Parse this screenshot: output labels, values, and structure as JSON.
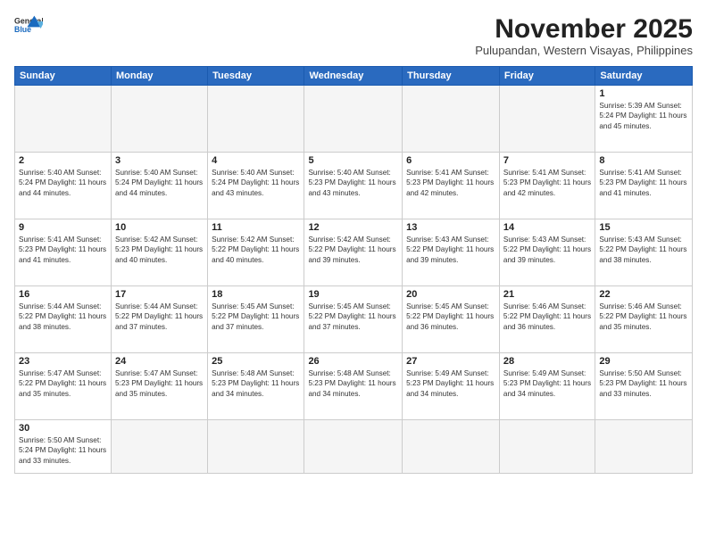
{
  "header": {
    "logo_line1": "General",
    "logo_line2": "Blue",
    "month_title": "November 2025",
    "location": "Pulupandan, Western Visayas, Philippines"
  },
  "days_of_week": [
    "Sunday",
    "Monday",
    "Tuesday",
    "Wednesday",
    "Thursday",
    "Friday",
    "Saturday"
  ],
  "weeks": [
    [
      {
        "day": "",
        "info": ""
      },
      {
        "day": "",
        "info": ""
      },
      {
        "day": "",
        "info": ""
      },
      {
        "day": "",
        "info": ""
      },
      {
        "day": "",
        "info": ""
      },
      {
        "day": "",
        "info": ""
      },
      {
        "day": "1",
        "info": "Sunrise: 5:39 AM\nSunset: 5:24 PM\nDaylight: 11 hours\nand 45 minutes."
      }
    ],
    [
      {
        "day": "2",
        "info": "Sunrise: 5:40 AM\nSunset: 5:24 PM\nDaylight: 11 hours\nand 44 minutes."
      },
      {
        "day": "3",
        "info": "Sunrise: 5:40 AM\nSunset: 5:24 PM\nDaylight: 11 hours\nand 44 minutes."
      },
      {
        "day": "4",
        "info": "Sunrise: 5:40 AM\nSunset: 5:24 PM\nDaylight: 11 hours\nand 43 minutes."
      },
      {
        "day": "5",
        "info": "Sunrise: 5:40 AM\nSunset: 5:23 PM\nDaylight: 11 hours\nand 43 minutes."
      },
      {
        "day": "6",
        "info": "Sunrise: 5:41 AM\nSunset: 5:23 PM\nDaylight: 11 hours\nand 42 minutes."
      },
      {
        "day": "7",
        "info": "Sunrise: 5:41 AM\nSunset: 5:23 PM\nDaylight: 11 hours\nand 42 minutes."
      },
      {
        "day": "8",
        "info": "Sunrise: 5:41 AM\nSunset: 5:23 PM\nDaylight: 11 hours\nand 41 minutes."
      }
    ],
    [
      {
        "day": "9",
        "info": "Sunrise: 5:41 AM\nSunset: 5:23 PM\nDaylight: 11 hours\nand 41 minutes."
      },
      {
        "day": "10",
        "info": "Sunrise: 5:42 AM\nSunset: 5:23 PM\nDaylight: 11 hours\nand 40 minutes."
      },
      {
        "day": "11",
        "info": "Sunrise: 5:42 AM\nSunset: 5:22 PM\nDaylight: 11 hours\nand 40 minutes."
      },
      {
        "day": "12",
        "info": "Sunrise: 5:42 AM\nSunset: 5:22 PM\nDaylight: 11 hours\nand 39 minutes."
      },
      {
        "day": "13",
        "info": "Sunrise: 5:43 AM\nSunset: 5:22 PM\nDaylight: 11 hours\nand 39 minutes."
      },
      {
        "day": "14",
        "info": "Sunrise: 5:43 AM\nSunset: 5:22 PM\nDaylight: 11 hours\nand 39 minutes."
      },
      {
        "day": "15",
        "info": "Sunrise: 5:43 AM\nSunset: 5:22 PM\nDaylight: 11 hours\nand 38 minutes."
      }
    ],
    [
      {
        "day": "16",
        "info": "Sunrise: 5:44 AM\nSunset: 5:22 PM\nDaylight: 11 hours\nand 38 minutes."
      },
      {
        "day": "17",
        "info": "Sunrise: 5:44 AM\nSunset: 5:22 PM\nDaylight: 11 hours\nand 37 minutes."
      },
      {
        "day": "18",
        "info": "Sunrise: 5:45 AM\nSunset: 5:22 PM\nDaylight: 11 hours\nand 37 minutes."
      },
      {
        "day": "19",
        "info": "Sunrise: 5:45 AM\nSunset: 5:22 PM\nDaylight: 11 hours\nand 37 minutes."
      },
      {
        "day": "20",
        "info": "Sunrise: 5:45 AM\nSunset: 5:22 PM\nDaylight: 11 hours\nand 36 minutes."
      },
      {
        "day": "21",
        "info": "Sunrise: 5:46 AM\nSunset: 5:22 PM\nDaylight: 11 hours\nand 36 minutes."
      },
      {
        "day": "22",
        "info": "Sunrise: 5:46 AM\nSunset: 5:22 PM\nDaylight: 11 hours\nand 35 minutes."
      }
    ],
    [
      {
        "day": "23",
        "info": "Sunrise: 5:47 AM\nSunset: 5:22 PM\nDaylight: 11 hours\nand 35 minutes."
      },
      {
        "day": "24",
        "info": "Sunrise: 5:47 AM\nSunset: 5:23 PM\nDaylight: 11 hours\nand 35 minutes."
      },
      {
        "day": "25",
        "info": "Sunrise: 5:48 AM\nSunset: 5:23 PM\nDaylight: 11 hours\nand 34 minutes."
      },
      {
        "day": "26",
        "info": "Sunrise: 5:48 AM\nSunset: 5:23 PM\nDaylight: 11 hours\nand 34 minutes."
      },
      {
        "day": "27",
        "info": "Sunrise: 5:49 AM\nSunset: 5:23 PM\nDaylight: 11 hours\nand 34 minutes."
      },
      {
        "day": "28",
        "info": "Sunrise: 5:49 AM\nSunset: 5:23 PM\nDaylight: 11 hours\nand 34 minutes."
      },
      {
        "day": "29",
        "info": "Sunrise: 5:50 AM\nSunset: 5:23 PM\nDaylight: 11 hours\nand 33 minutes."
      }
    ],
    [
      {
        "day": "30",
        "info": "Sunrise: 5:50 AM\nSunset: 5:24 PM\nDaylight: 11 hours\nand 33 minutes."
      },
      {
        "day": "",
        "info": ""
      },
      {
        "day": "",
        "info": ""
      },
      {
        "day": "",
        "info": ""
      },
      {
        "day": "",
        "info": ""
      },
      {
        "day": "",
        "info": ""
      },
      {
        "day": "",
        "info": ""
      }
    ]
  ]
}
